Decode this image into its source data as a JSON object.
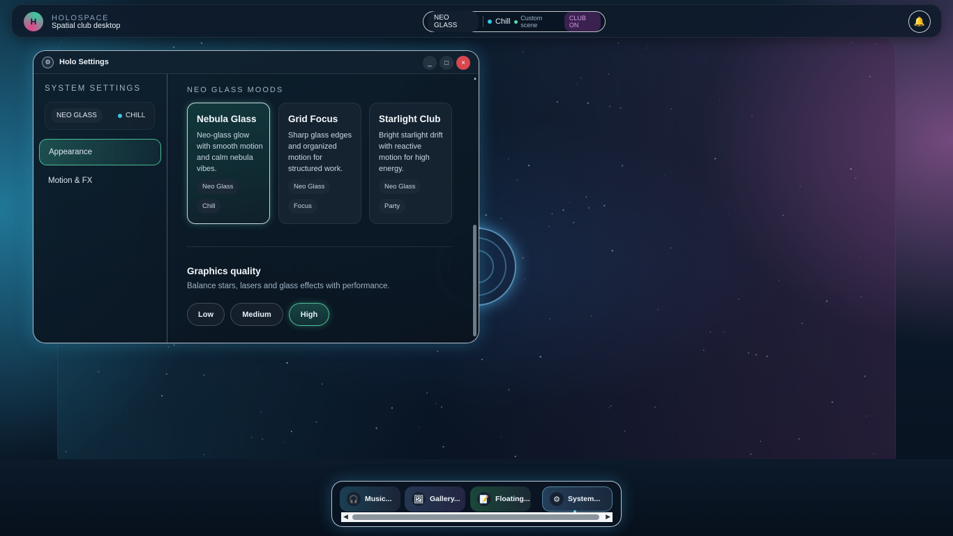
{
  "topbar": {
    "avatar_letter": "H",
    "brand_name": "HOLOSPACE",
    "brand_tagline": "Spatial club desktop",
    "status": {
      "theme": "NEO GLASS",
      "mood": "Chill",
      "scene": "Custom scene",
      "club": "CLUB ON"
    },
    "bell_icon": "bell-icon"
  },
  "window": {
    "title": "Holo Settings",
    "title_icon": "gear-icon",
    "controls": {
      "minimize": "_",
      "maximize": "□",
      "close": "×"
    },
    "sidebar": {
      "heading": "SYSTEM SETTINGS",
      "chip_theme": "NEO GLASS",
      "chip_mood": "CHILL",
      "items": [
        {
          "label": "Appearance",
          "active": true
        },
        {
          "label": "Motion & FX",
          "active": false
        }
      ]
    },
    "content": {
      "moods_heading": "NEO GLASS MOODS",
      "moods": [
        {
          "title": "Nebula Glass",
          "desc": "Neo-glass glow with smooth motion and calm nebula vibes.",
          "tags": [
            "Neo Glass",
            "Chill"
          ],
          "selected": true
        },
        {
          "title": "Grid Focus",
          "desc": "Sharp glass edges and organized motion for structured work.",
          "tags": [
            "Neo Glass",
            "Focus"
          ],
          "selected": false
        },
        {
          "title": "Starlight Club",
          "desc": "Bright starlight drift with reactive motion for high energy.",
          "tags": [
            "Neo Glass",
            "Party"
          ],
          "selected": false
        }
      ],
      "graphics": {
        "title": "Graphics quality",
        "desc": "Balance stars, lasers and glass effects with performance.",
        "options": [
          "Low",
          "Medium",
          "High"
        ],
        "selected": "High"
      }
    }
  },
  "dock": {
    "items": [
      {
        "label": "Music...",
        "icon": "headphones-icon"
      },
      {
        "label": "Gallery...",
        "icon": "image-icon"
      },
      {
        "label": "Floating...",
        "icon": "note-icon"
      },
      {
        "label": "System...",
        "icon": "gear-icon"
      }
    ]
  },
  "colors": {
    "accent_teal": "#5adcaa",
    "accent_cyan": "#38c8e8",
    "close_red": "#d8474f",
    "club_purple": "#d59ae6"
  }
}
